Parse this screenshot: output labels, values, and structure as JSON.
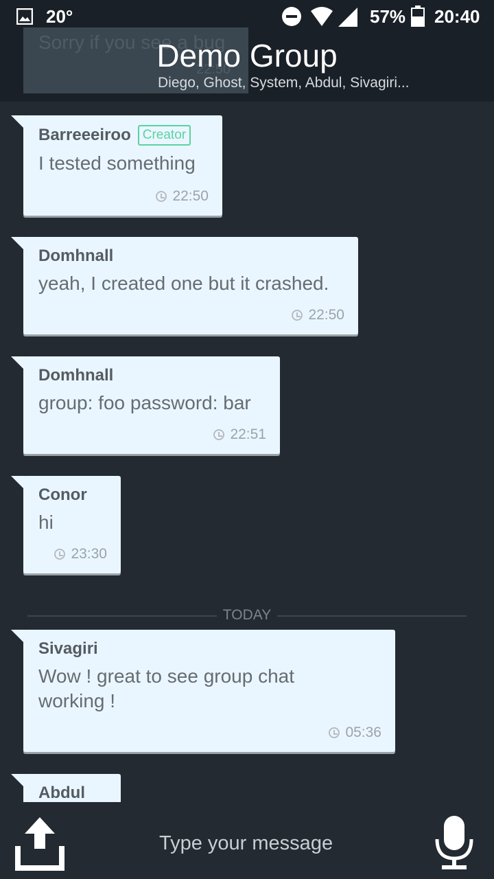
{
  "status_bar": {
    "temperature": "20°",
    "battery": "57%",
    "time": "20:40"
  },
  "header": {
    "title": "Demo Group",
    "members": "Diego, Ghost, System, Abdul, Sivagiri..."
  },
  "faded_message": {
    "text": "Sorry if you see a bug",
    "time": "22:50"
  },
  "messages": [
    {
      "sender": "Barreeeiroo",
      "badge": "Creator",
      "text": "I tested something",
      "time": "22:50"
    },
    {
      "sender": "Domhnall",
      "text": "yeah, I created one but it crashed.",
      "time": "22:50"
    },
    {
      "sender": "Domhnall",
      "text": "group: foo password: bar",
      "time": "22:51"
    },
    {
      "sender": "Conor",
      "text": "hi",
      "time": "23:30"
    },
    {
      "sender": "Sivagiri",
      "text": "Wow ! great to see group chat working !",
      "time": "05:36"
    },
    {
      "sender": "Abdul"
    }
  ],
  "divider": {
    "label": "TODAY"
  },
  "composer": {
    "placeholder": "Type your message",
    "icons": [
      "upload-icon",
      "microphone-icon"
    ]
  },
  "colors": {
    "background": "#232a31",
    "bubble": "#eaf6ff",
    "creator_badge": "#5ad3a0"
  }
}
